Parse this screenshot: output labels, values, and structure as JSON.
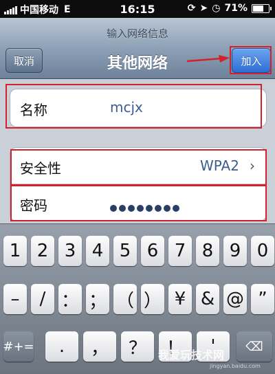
{
  "status_bar": {
    "carrier": "中国移动",
    "network": "E",
    "time": "16:15",
    "battery": "71%",
    "battery_level": 0.71
  },
  "nav": {
    "prompt": "输入网络信息",
    "title": "其他网络",
    "cancel_label": "取消",
    "join_label": "加入"
  },
  "form": {
    "name_label": "名称",
    "name_value": "mcjx",
    "security_label": "安全性",
    "security_value": "WPA2",
    "password_label": "密码",
    "password_dot_count": 8
  },
  "keyboard": {
    "row1": [
      "1",
      "2",
      "3",
      "4",
      "5",
      "6",
      "7",
      "8",
      "9",
      "0"
    ],
    "row2": [
      "–",
      "/",
      "：",
      "；",
      "（",
      "）",
      "¥",
      "&",
      "@",
      "”"
    ],
    "symbols_key": "#+=",
    "row3": [
      ".",
      "，",
      "？",
      "！",
      "'"
    ]
  },
  "watermark": {
    "text": "我爱玩技术网",
    "sub": "jingyan.baidu.com"
  },
  "colors": {
    "highlight": "#d4202a",
    "join_button": "#2e6fd4",
    "security_value": "#3d5d8e"
  }
}
